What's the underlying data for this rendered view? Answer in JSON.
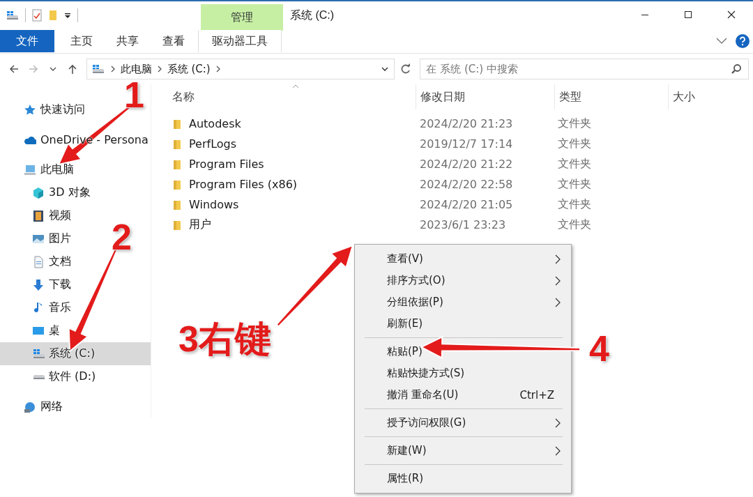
{
  "window": {
    "title": "系统 (C:)",
    "context_tab": "管理"
  },
  "ribbon_tabs": [
    {
      "label": "文件",
      "kind": "file"
    },
    {
      "label": "主页",
      "kind": "normal"
    },
    {
      "label": "共享",
      "kind": "normal"
    },
    {
      "label": "查看",
      "kind": "normal"
    },
    {
      "label": "驱动器工具",
      "kind": "context"
    }
  ],
  "address_bar": {
    "breadcrumbs": [
      "此电脑",
      "系统 (C:)"
    ]
  },
  "search": {
    "placeholder": "在 系统 (C:) 中搜索"
  },
  "sidebar": {
    "items": [
      {
        "label": "快速访问",
        "kind": "star",
        "selected": false
      },
      {
        "label": "OneDrive - Persona",
        "kind": "cloud",
        "selected": false
      },
      {
        "label": "此电脑",
        "kind": "pc",
        "selected": false,
        "children": [
          {
            "label": "3D 对象",
            "kind": "cube",
            "selected": false
          },
          {
            "label": "视频",
            "kind": "film",
            "selected": false
          },
          {
            "label": "图片",
            "kind": "image",
            "selected": false
          },
          {
            "label": "文档",
            "kind": "doc",
            "selected": false
          },
          {
            "label": "下载",
            "kind": "download",
            "selected": false
          },
          {
            "label": "音乐",
            "kind": "music",
            "selected": false
          },
          {
            "label": "桌",
            "kind": "desktop",
            "selected": false
          },
          {
            "label": "系统 (C:)",
            "kind": "drive-c",
            "selected": true
          },
          {
            "label": "软件 (D:)",
            "kind": "drive",
            "selected": false
          }
        ]
      },
      {
        "label": "网络",
        "kind": "network",
        "selected": false
      }
    ]
  },
  "table": {
    "columns": [
      {
        "label": "名称",
        "sorted": true
      },
      {
        "label": "修改日期",
        "sorted": false
      },
      {
        "label": "类型",
        "sorted": false
      },
      {
        "label": "大小",
        "sorted": false
      }
    ],
    "rows": [
      {
        "name": "Autodesk",
        "modified": "2024/2/20 21:23",
        "type": "文件夹"
      },
      {
        "name": "PerfLogs",
        "modified": "2019/12/7 17:14",
        "type": "文件夹"
      },
      {
        "name": "Program Files",
        "modified": "2024/2/20 21:22",
        "type": "文件夹"
      },
      {
        "name": "Program Files (x86)",
        "modified": "2024/2/20 22:58",
        "type": "文件夹"
      },
      {
        "name": "Windows",
        "modified": "2024/2/20 21:05",
        "type": "文件夹"
      },
      {
        "name": "用户",
        "modified": "2023/6/1 23:23",
        "type": "文件夹"
      }
    ]
  },
  "context_menu": {
    "items": [
      {
        "kind": "item",
        "label": "查看(V)",
        "submenu": true
      },
      {
        "kind": "item",
        "label": "排序方式(O)",
        "submenu": true
      },
      {
        "kind": "item",
        "label": "分组依据(P)",
        "submenu": true
      },
      {
        "kind": "item",
        "label": "刷新(E)",
        "submenu": false
      },
      {
        "kind": "separator"
      },
      {
        "kind": "item",
        "label": "粘贴(P)",
        "submenu": false
      },
      {
        "kind": "item",
        "label": "粘贴快捷方式(S)",
        "submenu": false
      },
      {
        "kind": "item",
        "label": "撤消 重命名(U)",
        "shortcut": "Ctrl+Z",
        "submenu": false
      },
      {
        "kind": "separator"
      },
      {
        "kind": "item",
        "label": "授予访问权限(G)",
        "submenu": true
      },
      {
        "kind": "separator"
      },
      {
        "kind": "item",
        "label": "新建(W)",
        "submenu": true
      },
      {
        "kind": "separator"
      },
      {
        "kind": "item",
        "label": "属性(R)",
        "submenu": false
      }
    ]
  },
  "annotations": [
    {
      "label": "1"
    },
    {
      "label": "2"
    },
    {
      "label": "3右键"
    },
    {
      "label": "4"
    }
  ]
}
